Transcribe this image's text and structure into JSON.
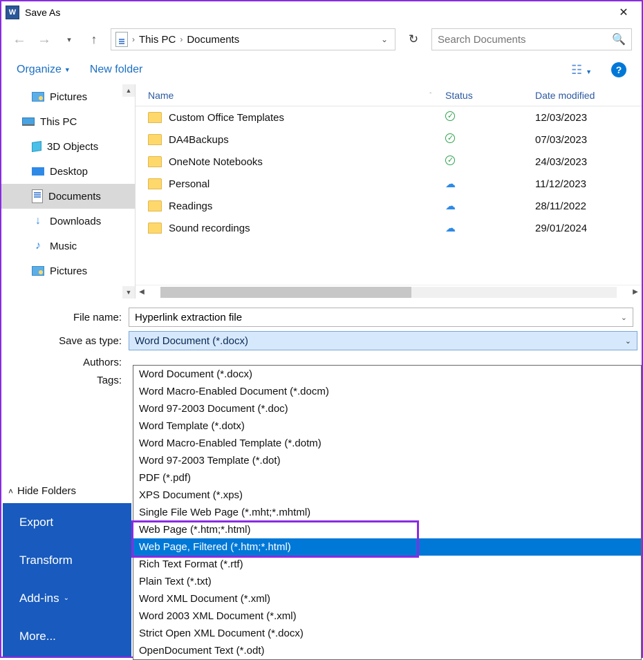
{
  "window": {
    "title": "Save As"
  },
  "breadcrumb": {
    "item1": "This PC",
    "item2": "Documents"
  },
  "search": {
    "placeholder": "Search Documents"
  },
  "toolbar": {
    "organize": "Organize",
    "new_folder": "New folder"
  },
  "sidebar": {
    "items": [
      {
        "label": "Pictures",
        "indent": "child"
      },
      {
        "label": "This PC",
        "indent": "parent"
      },
      {
        "label": "3D Objects",
        "indent": "child"
      },
      {
        "label": "Desktop",
        "indent": "child"
      },
      {
        "label": "Documents",
        "indent": "child",
        "selected": true
      },
      {
        "label": "Downloads",
        "indent": "child"
      },
      {
        "label": "Music",
        "indent": "child"
      },
      {
        "label": "Pictures",
        "indent": "child"
      }
    ]
  },
  "columns": {
    "name": "Name",
    "status": "Status",
    "date": "Date modified"
  },
  "rows": [
    {
      "name": "Custom Office Templates",
      "status": "check",
      "date": "12/03/2023"
    },
    {
      "name": "DA4Backups",
      "status": "check",
      "date": "07/03/2023"
    },
    {
      "name": "OneNote Notebooks",
      "status": "check",
      "date": "24/03/2023"
    },
    {
      "name": "Personal",
      "status": "cloud",
      "date": "11/12/2023"
    },
    {
      "name": "Readings",
      "status": "cloud",
      "date": "28/11/2022"
    },
    {
      "name": "Sound recordings",
      "status": "cloud",
      "date": "29/01/2024"
    }
  ],
  "form": {
    "filename_label": "File name:",
    "filename_value": "Hyperlink extraction file",
    "type_label": "Save as type:",
    "type_value": "Word Document (*.docx)",
    "authors_label": "Authors:",
    "tags_label": "Tags:"
  },
  "options": [
    "Word Document (*.docx)",
    "Word Macro-Enabled Document (*.docm)",
    "Word 97-2003 Document (*.doc)",
    "Word Template (*.dotx)",
    "Word Macro-Enabled Template (*.dotm)",
    "Word 97-2003 Template (*.dot)",
    "PDF (*.pdf)",
    "XPS Document (*.xps)",
    "Single File Web Page (*.mht;*.mhtml)",
    "Web Page (*.htm;*.html)",
    "Web Page, Filtered (*.htm;*.html)",
    "Rich Text Format (*.rtf)",
    "Plain Text (*.txt)",
    "Word XML Document (*.xml)",
    "Word 2003 XML Document (*.xml)",
    "Strict Open XML Document (*.docx)",
    "OpenDocument Text (*.odt)"
  ],
  "selected_option_index": 10,
  "hide_folders": "Hide Folders",
  "backstage": {
    "export": "Export",
    "transform": "Transform",
    "addins": "Add-ins",
    "more": "More..."
  }
}
